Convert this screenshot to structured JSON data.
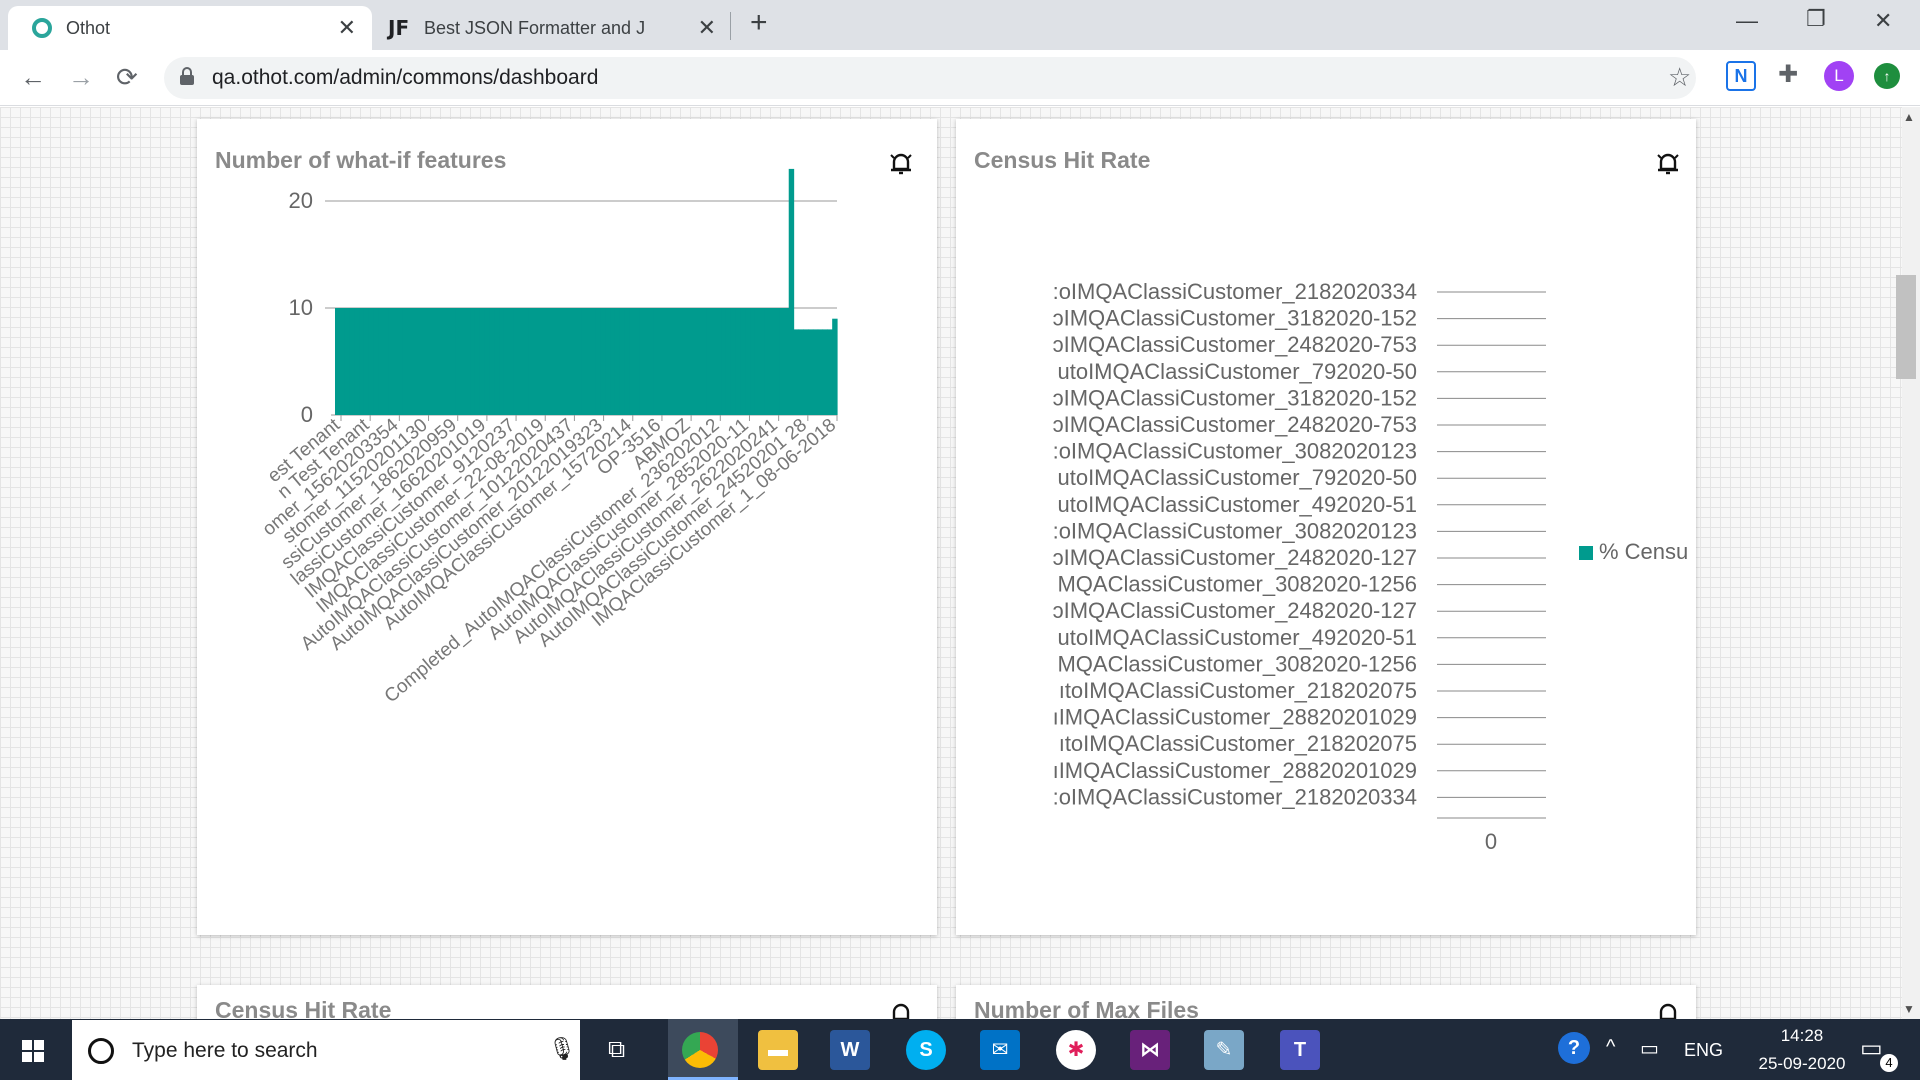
{
  "browser": {
    "tabs": [
      {
        "title": "Othot",
        "active": true
      },
      {
        "title": "Best JSON Formatter and JSON V",
        "icon_text": "JF",
        "active": false
      }
    ],
    "url": "qa.othot.com/admin/commons/dashboard",
    "profile_initial": "L"
  },
  "cards": {
    "whatif": {
      "title": "Number of what-if features",
      "chart_data": {
        "type": "bar",
        "ylim": [
          0,
          23
        ],
        "yticks": [
          0,
          10,
          20
        ],
        "color": "#009b8e",
        "categories": [
          "est Tenant",
          "n Test Tenant",
          "omer_15620203354",
          "stomer_11520201130",
          "ssiCustomer_1862020959",
          "lassiCustomer_16620201019",
          "IMQAClassiCustomer_9120237",
          "IMQAClassiCustomer_22-08-2019",
          "AutoIMQAClassiCustomer_10122020437",
          "AutoIMQAClassiCustomer_20122019323",
          "AutoIMQAClassiCustomer_15720214",
          "OP-3516",
          "ABMOZ",
          "Completed_AutoIMQAClassiCustomer_236202012",
          "AutoIMQAClassiCustomer_2852020-11",
          "AutoIMQAClassiCustomer_2622020241",
          "AutoIMQAClassiCustomer_24520201 28",
          "IMQAClassiCustomer_1_08-06-2018"
        ],
        "values": [
          10,
          10,
          10,
          10,
          10,
          10,
          10,
          10,
          10,
          10,
          10,
          10,
          10,
          10,
          10,
          10,
          10,
          10,
          10,
          10,
          10,
          10,
          10,
          10,
          10,
          10,
          10,
          10,
          10,
          10,
          10,
          10,
          10,
          10,
          10,
          10,
          10,
          10,
          10,
          10,
          10,
          10,
          10,
          10,
          10,
          10,
          10,
          10,
          10,
          10,
          10,
          10,
          10,
          10,
          10,
          10,
          10,
          10,
          10,
          10,
          10,
          10,
          10,
          10,
          10,
          10,
          10,
          10,
          10,
          10,
          10,
          10,
          10,
          10,
          10,
          10,
          10,
          10,
          10,
          10,
          10,
          10,
          10,
          10,
          10,
          10,
          10,
          10,
          10,
          10,
          10,
          10,
          10,
          10,
          23,
          8,
          8,
          8,
          8,
          8,
          8,
          8,
          8,
          9
        ]
      }
    },
    "census": {
      "title": "Census Hit Rate",
      "chart_data": {
        "type": "bar",
        "orientation": "horizontal",
        "categories": [
          ":oIMQAClassiCustomer_2182020334",
          "ɔIMQAClassiCustomer_3182020-152",
          "ɔIMQAClassiCustomer_2482020-753",
          "utoIMQAClassiCustomer_792020-50",
          "ɔIMQAClassiCustomer_3182020-152",
          "ɔIMQAClassiCustomer_2482020-753",
          ":oIMQAClassiCustomer_3082020123",
          "utoIMQAClassiCustomer_792020-50",
          "utoIMQAClassiCustomer_492020-51",
          ":oIMQAClassiCustomer_3082020123",
          "ɔIMQAClassiCustomer_2482020-127",
          "MQAClassiCustomer_3082020-1256",
          "ɔIMQAClassiCustomer_2482020-127",
          "utoIMQAClassiCustomer_492020-51",
          "MQAClassiCustomer_3082020-1256",
          "ıtoIMQAClassiCustomer_218202075",
          "ıIMQAClassiCustomer_28820201029",
          "ıtoIMQAClassiCustomer_218202075",
          "ıIMQAClassiCustomer_28820201029",
          ":oIMQAClassiCustomer_2182020334"
        ],
        "values": [
          0,
          0,
          0,
          0,
          0,
          0,
          0,
          0,
          0,
          0,
          0,
          0,
          0,
          0,
          0,
          0,
          0,
          0,
          0,
          0
        ],
        "xticks": [
          "0"
        ],
        "legend": "% Censu",
        "legend_position": "right",
        "color": "#009b8e"
      }
    },
    "bottom_left_partial_title": "Census Hit Rate",
    "bottom_right_partial_title": "Number of Max Files"
  },
  "taskbar": {
    "search_placeholder": "Type here to search",
    "language": "ENG",
    "time": "14:28",
    "date": "25-09-2020",
    "notification_count": "4"
  },
  "colors": {
    "accent": "#009b8e",
    "taskbar": "#1f2a3a",
    "card_title": "#8a8a8a"
  }
}
